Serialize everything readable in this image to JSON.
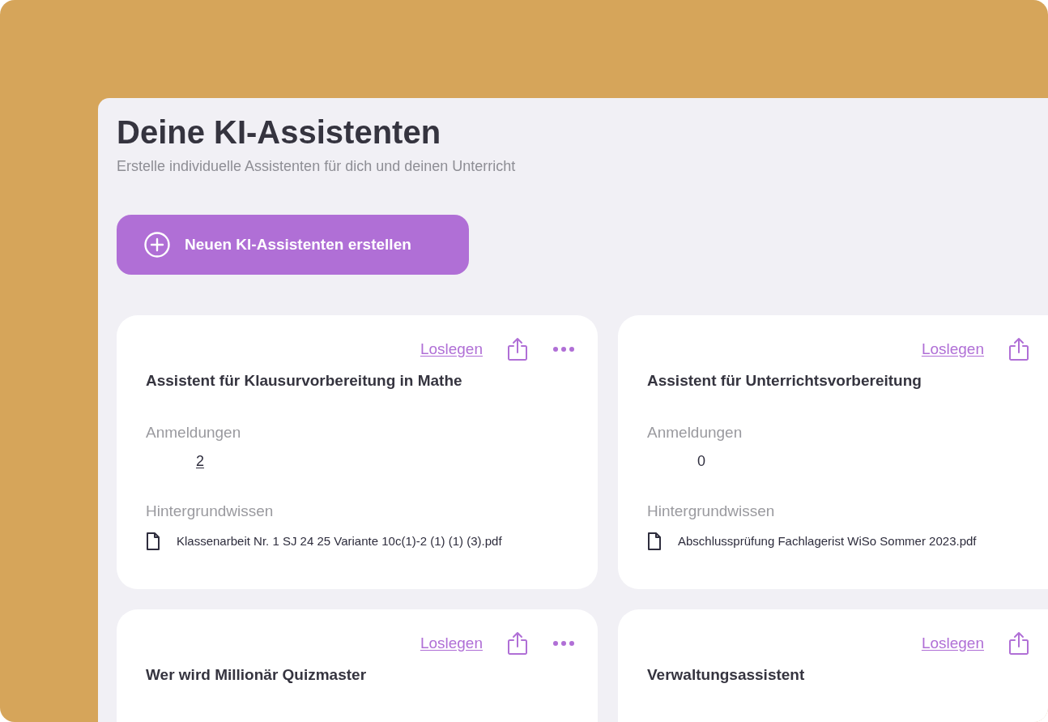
{
  "page": {
    "title": "Deine KI-Assistenten",
    "subtitle": "Erstelle individuelle Assistenten für dich und deinen Unterricht"
  },
  "create_button": {
    "label": "Neuen KI-Assistenten erstellen"
  },
  "cards": [
    {
      "title": "Assistent für Klausurvorbereitung in Mathe",
      "start_link": "Loslegen",
      "menu_button": true,
      "signups": {
        "label": "Anmeldungen",
        "value": "2",
        "linked": true
      },
      "knowledge": {
        "label": "Hintergrundwissen",
        "files": [
          "Klassenarbeit Nr. 1 SJ 24 25 Variante 10c(1)-2 (1) (1) (3).pdf"
        ]
      }
    },
    {
      "title": "Assistent für Unterrichtsvorbereitung",
      "start_link": "Loslegen",
      "menu_button": false,
      "signups": {
        "label": "Anmeldungen",
        "value": "0",
        "linked": false
      },
      "knowledge": {
        "label": "Hintergrundwissen",
        "files": [
          "Abschlussprüfung Fachlagerist WiSo Sommer 2023.pdf"
        ]
      }
    },
    {
      "title": "Wer wird Millionär Quizmaster",
      "start_link": "Loslegen",
      "menu_button": true
    },
    {
      "title": "Verwaltungsassistent",
      "start_link": "Loslegen",
      "menu_button": false
    }
  ]
}
